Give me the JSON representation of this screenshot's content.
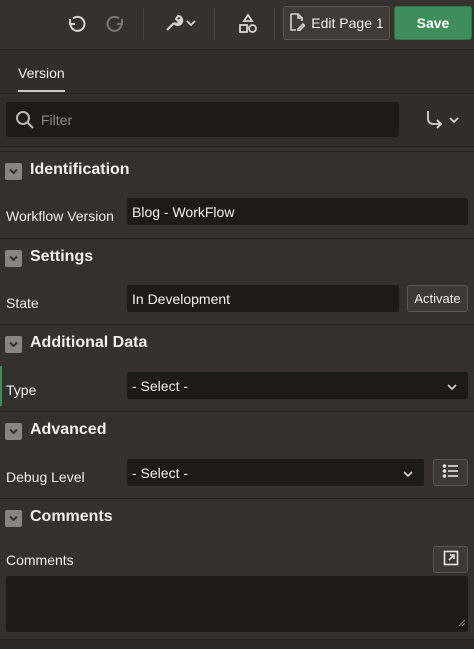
{
  "toolbar": {
    "undo_icon": "undo-icon",
    "redo_icon": "redo-icon",
    "utilities_icon": "wrench-icon",
    "shared_components_icon": "shapes-icon",
    "edit_page_label": "Edit Page 1",
    "save_label": "Save"
  },
  "tabs": [
    {
      "label": "Version"
    }
  ],
  "filter": {
    "placeholder": "Filter"
  },
  "sections": {
    "identification": {
      "title": "Identification",
      "workflow_version_label": "Workflow Version",
      "workflow_version_value": "Blog - WorkFlow"
    },
    "settings": {
      "title": "Settings",
      "state_label": "State",
      "state_value": "In Development",
      "activate_label": "Activate"
    },
    "additional_data": {
      "title": "Additional Data",
      "type_label": "Type",
      "type_value": "- Select -"
    },
    "advanced": {
      "title": "Advanced",
      "debug_level_label": "Debug Level",
      "debug_level_value": "- Select -"
    },
    "comments": {
      "title": "Comments",
      "comments_label": "Comments",
      "comments_value": ""
    }
  },
  "colors": {
    "background": "#34302c",
    "field": "#1d1b18",
    "save": "#3f8d5a"
  }
}
